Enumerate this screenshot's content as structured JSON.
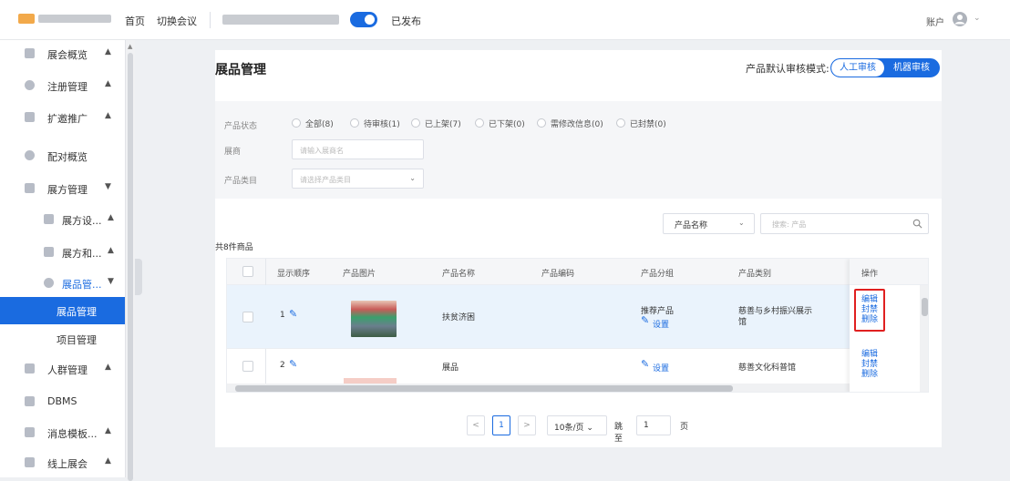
{
  "topbar": {
    "nav": [
      "首页",
      "切换会议"
    ],
    "published_label": "已发布",
    "account_label": "账户",
    "colors": {
      "accent": "#1a6be0"
    }
  },
  "sidebar": {
    "items": [
      {
        "label": "展会概览",
        "icon": "grid-icon",
        "arrow": "▲"
      },
      {
        "label": "注册管理",
        "icon": "user-icon",
        "arrow": "▲"
      },
      {
        "label": "扩邀推广",
        "icon": "chart-icon",
        "arrow": "▲"
      },
      {
        "label": "配对概览",
        "icon": "circle-icon",
        "arrow": ""
      },
      {
        "label": "展方管理",
        "icon": "layers-icon",
        "arrow": "▼"
      },
      {
        "label": "展方设...",
        "icon": "layers-icon",
        "arrow": "▲"
      },
      {
        "label": "展方和...",
        "icon": "doc-icon",
        "arrow": "▲"
      },
      {
        "label": "展品管...",
        "icon": "box-icon",
        "arrow": "▼"
      },
      {
        "label": "展品管理",
        "icon": "",
        "arrow": ""
      },
      {
        "label": "项目管理",
        "icon": "",
        "arrow": ""
      },
      {
        "label": "人群管理",
        "icon": "people-icon",
        "arrow": "▲"
      },
      {
        "label": "DBMS",
        "icon": "database-icon",
        "arrow": ""
      },
      {
        "label": "消息模板...",
        "icon": "bell-icon",
        "arrow": "▲"
      },
      {
        "label": "线上展会",
        "icon": "monitor-icon",
        "arrow": "▲"
      }
    ]
  },
  "main": {
    "title": "展品管理",
    "review_mode": {
      "label": "产品默认审核模式:",
      "options": [
        "人工审核",
        "机器审核"
      ],
      "selected": "人工审核"
    },
    "filter": {
      "status_label": "产品状态",
      "status_options": [
        "全部(8)",
        "待审核(1)",
        "已上架(7)",
        "已下架(0)",
        "需修改信息(0)",
        "已封禁(0)"
      ],
      "vendor_label": "展商",
      "vendor_placeholder": "请输入展商名",
      "category_label": "产品类目",
      "category_placeholder": "请选择产品类目"
    },
    "search": {
      "field_select": "产品名称",
      "placeholder": "搜索: 产品"
    },
    "count_text": "共8件商品",
    "table": {
      "columns": [
        "显示顺序",
        "产品图片",
        "产品名称",
        "产品编码",
        "产品分组",
        "产品类别",
        "操作"
      ],
      "rows": [
        {
          "order": "1",
          "name": "扶贫济困",
          "code": "",
          "group": "推荐产品",
          "group_action": "设置",
          "category_line1": "慈善与乡村振兴展示",
          "category_line2": "馆",
          "actions": [
            "编辑",
            "封禁",
            "删除"
          ]
        },
        {
          "order": "2",
          "name": "展品",
          "code": "",
          "group": "",
          "group_action": "设置",
          "category_line1": "慈善文化科普馆",
          "category_line2": "",
          "actions": [
            "编辑",
            "封禁",
            "删除"
          ]
        }
      ]
    },
    "pagination": {
      "prev": "<",
      "current_page": "1",
      "next": ">",
      "page_size": "10条/页",
      "goto_label": "跳至",
      "goto_value": "1",
      "page_unit": "页"
    }
  }
}
